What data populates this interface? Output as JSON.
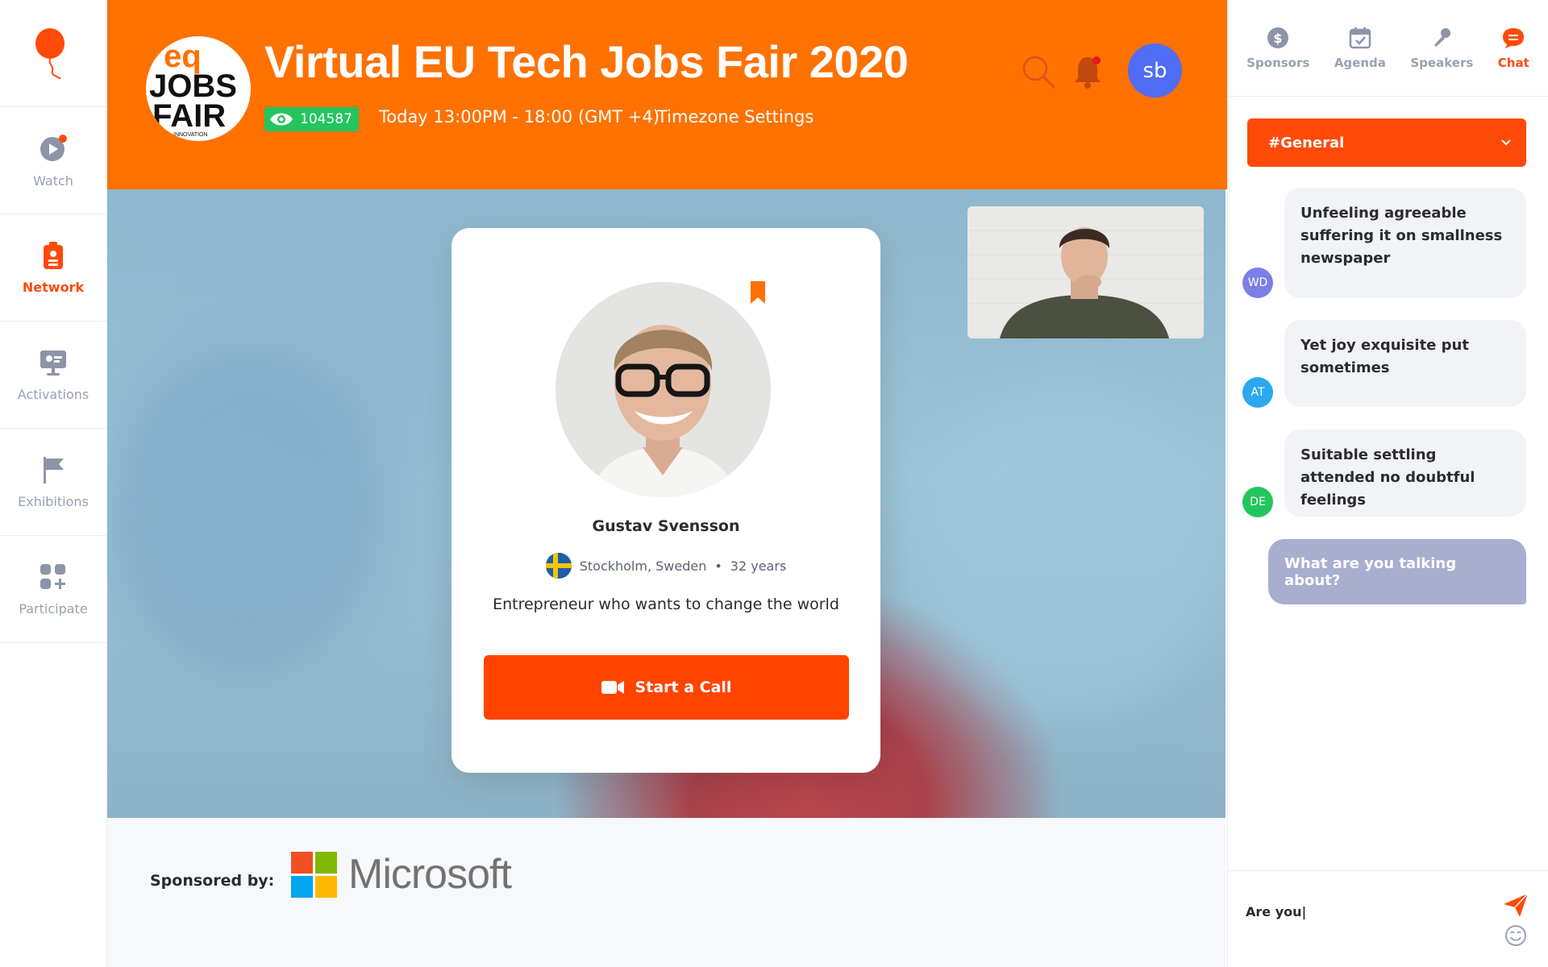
{
  "event": {
    "title": "Virtual EU Tech Jobs Fair 2020",
    "views": "104587",
    "time": "Today 13:00PM - 18:00 (GMT +4)",
    "timezone_link": "Timezone Settings",
    "logo_text_top": "eq",
    "logo_text_mid": "JOBS",
    "logo_text_bottom": "FAIR",
    "logo_text_small": "INNOVATION"
  },
  "user": {
    "initials": "sb"
  },
  "sidebar": {
    "items": [
      {
        "label": "Watch",
        "icon": "play-icon"
      },
      {
        "label": "Network",
        "icon": "badge-icon",
        "active": true
      },
      {
        "label": "Activations",
        "icon": "presentation-icon"
      },
      {
        "label": "Exhibitions",
        "icon": "flag-icon"
      },
      {
        "label": "Participate",
        "icon": "grid-plus-icon"
      }
    ]
  },
  "profile": {
    "name": "Gustav Svensson",
    "location": "Stockholm, Sweden",
    "age": "32 years",
    "bio": "Entrepreneur who wants to change the world",
    "cta": "Start a Call"
  },
  "sponsor": {
    "label": "Sponsored by:",
    "name": "Microsoft"
  },
  "right_panel": {
    "tabs": [
      {
        "label": "Sponsors",
        "icon": "dollar-icon"
      },
      {
        "label": "Agenda",
        "icon": "calendar-icon"
      },
      {
        "label": "Speakers",
        "icon": "microphone-icon"
      },
      {
        "label": "Chat",
        "icon": "chat-icon",
        "active": true
      }
    ],
    "channel": "#General",
    "messages": [
      {
        "initials": "WD",
        "text": "Unfeeling agreeable suffering it on smallness newspaper",
        "avatar_color": "#7b7fe6"
      },
      {
        "initials": "AT",
        "text": "Yet joy exquisite put sometimes",
        "avatar_color": "#2aa8f0"
      },
      {
        "initials": "DE",
        "text": "Suitable settling attended no doubtful feelings",
        "avatar_color": "#22c55e"
      }
    ],
    "own_message": "What are you talking about?",
    "composer_value": "Are you|"
  },
  "colors": {
    "brand_orange": "#ff7100",
    "accent_red_orange": "#ff4a0a",
    "views_badge": "#22c55e",
    "avatar_blue": "#4f6df5"
  }
}
